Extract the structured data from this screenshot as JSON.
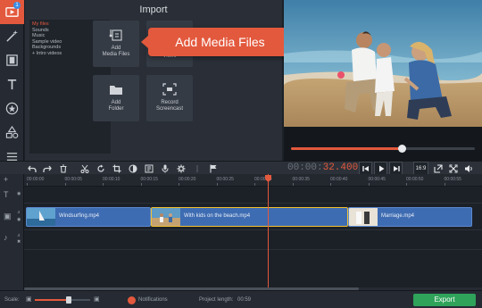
{
  "app": {
    "accent": "#e3593d",
    "notification_count": "1"
  },
  "sidebar_tools": [
    {
      "icon": "import-media-icon",
      "active": true
    },
    {
      "icon": "magic-wand-icon"
    },
    {
      "icon": "film-strip-icon"
    },
    {
      "icon": "text-tool-icon"
    },
    {
      "icon": "star-sticker-icon"
    },
    {
      "icon": "shapes-icon"
    },
    {
      "icon": "list-menu-icon"
    }
  ],
  "import": {
    "title": "Import",
    "tree": [
      {
        "label": "My files",
        "selected": true
      },
      {
        "label": "Sounds"
      },
      {
        "label": "Music"
      },
      {
        "label": "Sample video"
      },
      {
        "label": "Backgrounds"
      },
      {
        "label": "+ Intro videos"
      }
    ],
    "tiles": {
      "add_media": "Add\nMedia Files",
      "record_video": "Video",
      "add_folder": "Add\nFolder",
      "record_screencast": "Record\nScreencast"
    },
    "callout": "Add Media Files"
  },
  "player": {
    "progress_fraction": 0.6
  },
  "timecode": {
    "dim": "00:00:",
    "value": "32.400"
  },
  "edit_tools": [
    "undo-icon",
    "redo-icon",
    "delete-icon",
    "cut-icon",
    "rotate-icon",
    "crop-icon",
    "color-adjust-icon",
    "media-info-icon",
    "microphone-icon",
    "settings-gear-icon",
    "flag-marker-icon"
  ],
  "player_controls": {
    "aspect": "16:9",
    "buttons": [
      "skip-back-icon",
      "play-icon",
      "skip-forward-icon"
    ],
    "view_buttons": [
      "detach-icon",
      "fullscreen-icon",
      "volume-icon"
    ]
  },
  "ruler_ticks": [
    "00:00:00",
    "00:00:05",
    "00:00:10",
    "00:00:15",
    "00:00:20",
    "00:00:25",
    "00:00:30",
    "00:00:35",
    "00:00:40",
    "00:00:45",
    "00:00:50",
    "00:00:55"
  ],
  "clips": [
    {
      "name": "Windsurfing.mp4",
      "selected": false
    },
    {
      "name": "With kids on the beach.mp4",
      "selected": true
    },
    {
      "name": "Marriage.mp4",
      "selected": false
    }
  ],
  "bottom": {
    "scale_label": "Scale:",
    "scale_fraction": 0.62,
    "notifications": "Notifications",
    "project_length_label": "Project length:",
    "project_length": "00:59",
    "export": "Export"
  }
}
